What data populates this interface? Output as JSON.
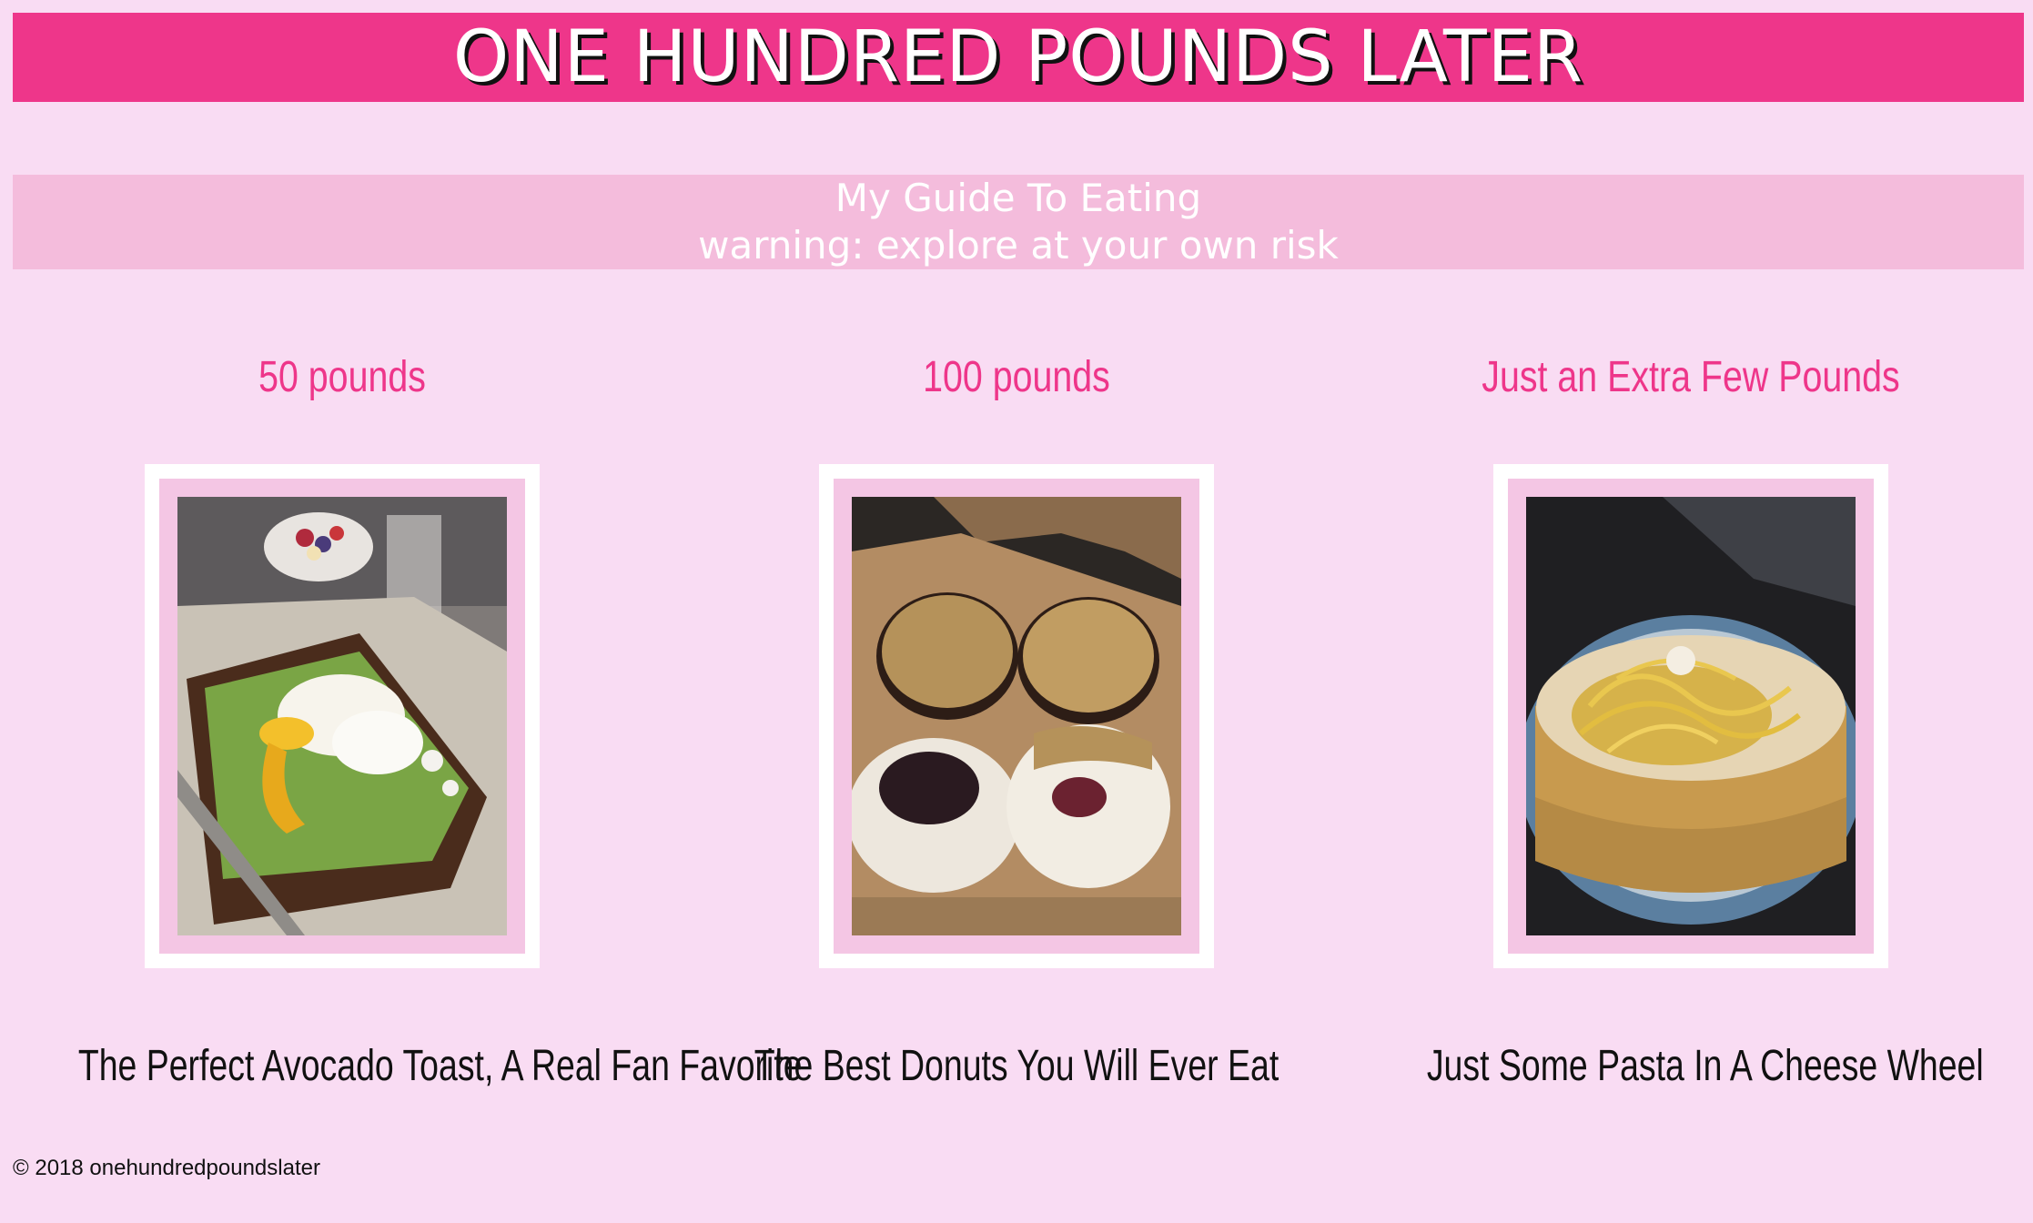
{
  "header": {
    "title": "ONE HUNDRED POUNDS LATER"
  },
  "subheader": {
    "line1": "My Guide To Eating",
    "line2": "warning: explore at your own risk"
  },
  "columns": [
    {
      "heading": "50 pounds",
      "caption": "The Perfect Avocado Toast, A Real Fan Favorite",
      "photo_subject": "avocado toast with poached eggs"
    },
    {
      "heading": "100 pounds",
      "caption": "The Best Donuts You Will Ever Eat",
      "photo_subject": "box of topped donuts"
    },
    {
      "heading": "Just an Extra Few Pounds",
      "caption": "Just Some Pasta In A Cheese Wheel",
      "photo_subject": "pasta in a cheese wheel"
    }
  ],
  "footer": {
    "text": "© 2018 onehundredpoundslater"
  },
  "colors": {
    "background": "#f9dcf3",
    "banner": "#ee368a",
    "subheader": "#f4bcdc",
    "heading_text": "#ee368a",
    "frame": "#ffffff",
    "frame_inner": "#f4c6e4"
  }
}
